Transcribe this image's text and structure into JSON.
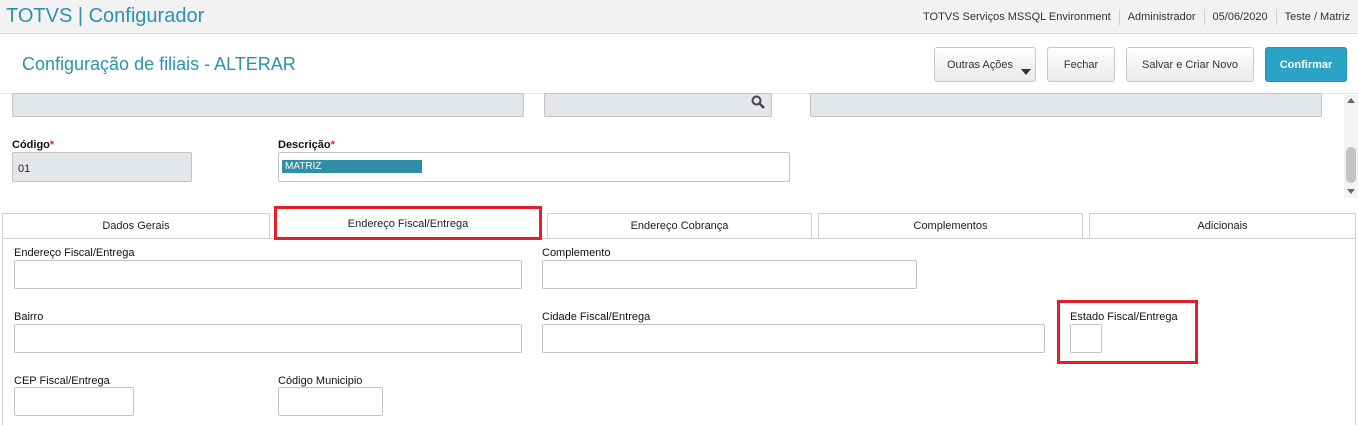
{
  "topbar": {
    "brand": "TOTVS | Configurador",
    "environment": "TOTVS Serviços MSSQL Environment",
    "user": "Administrador",
    "date": "05/06/2020",
    "branch": "Teste / Matriz"
  },
  "header": {
    "title": "Configuração de filiais - ALTERAR",
    "buttons": {
      "outras": "Outras Ações",
      "fechar": "Fechar",
      "salvar": "Salvar e Criar Novo",
      "confirmar": "Confirmar"
    }
  },
  "fields": {
    "codigo_label": "Código",
    "codigo_value": "01",
    "descricao_label": "Descrição",
    "descricao_value": "MATRIZ",
    "required_mark": "*"
  },
  "tabs": [
    {
      "label": "Dados Gerais"
    },
    {
      "label": "Endereço Fiscal/Entrega"
    },
    {
      "label": "Endereço Cobrança"
    },
    {
      "label": "Complementos"
    },
    {
      "label": "Adicionais"
    }
  ],
  "panel": {
    "endereco_label": "Endereço Fiscal/Entrega",
    "complemento_label": "Complemento",
    "bairro_label": "Bairro",
    "cidade_label": "Cidade Fiscal/Entrega",
    "estado_label": "Estado Fiscal/Entrega",
    "cep_label": "CEP Fiscal/Entrega",
    "municipio_label": "Código Municipio"
  },
  "colors": {
    "accent": "#2a92ad",
    "primary_button": "#2aa3c6",
    "highlight_box": "#e41e26"
  }
}
